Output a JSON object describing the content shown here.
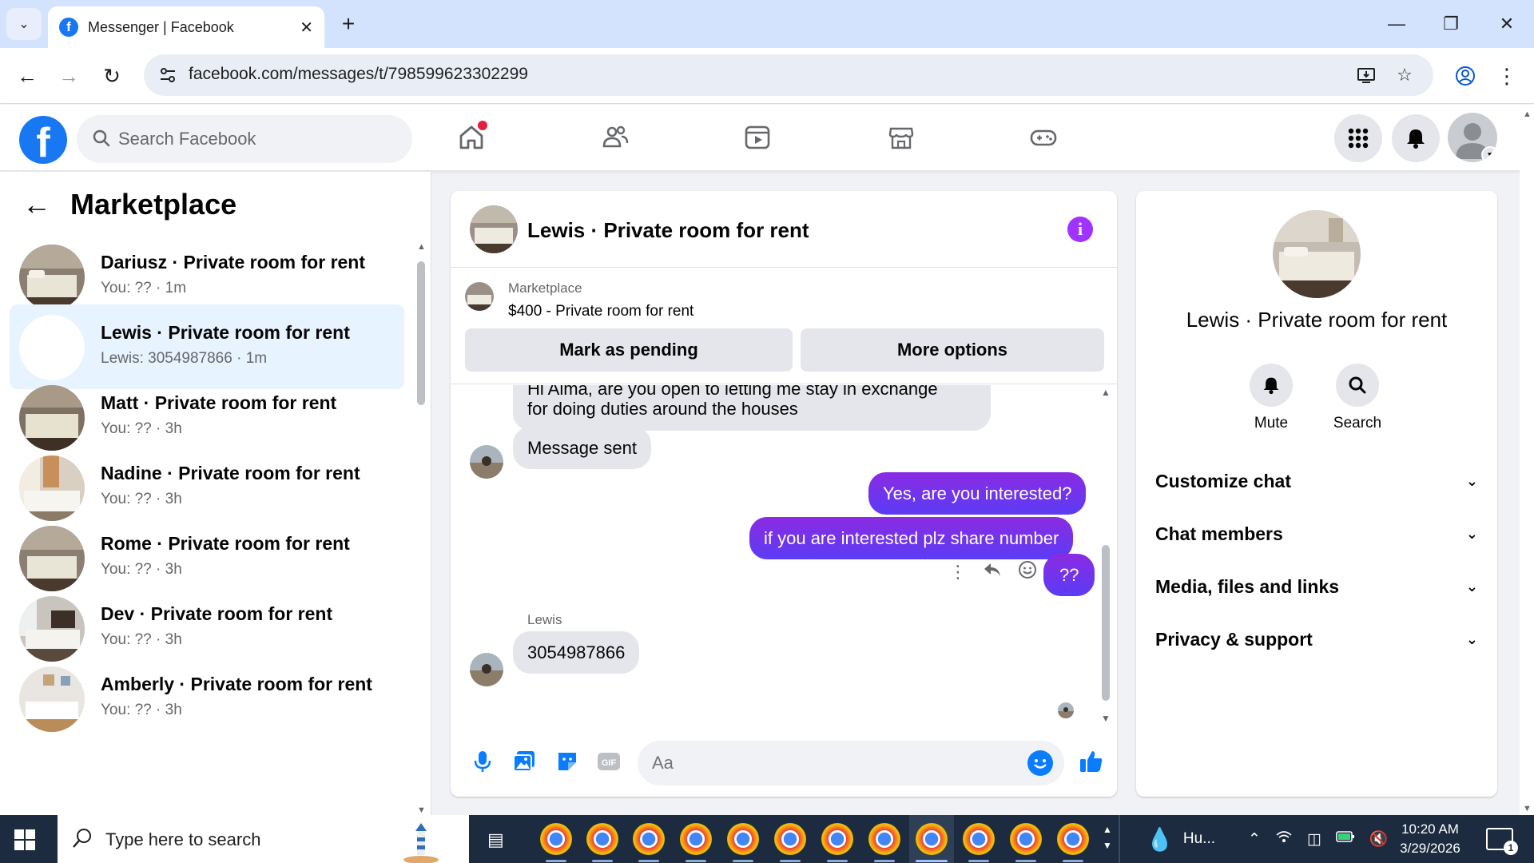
{
  "browser": {
    "tab_title": "Messenger | Facebook",
    "url": "facebook.com/messages/t/798599623302299"
  },
  "header": {
    "search_placeholder": "Search Facebook",
    "brand_color": "#1877f2"
  },
  "sidebar": {
    "title": "Marketplace",
    "conversations": [
      {
        "name": "Dariusz · Private room for rent",
        "sub": "You: ?? · 1m",
        "active": false
      },
      {
        "name": "Lewis · Private room for rent",
        "sub": "Lewis: 3054987866 · 1m",
        "active": true
      },
      {
        "name": "Matt · Private room for rent",
        "sub": "You: ?? · 3h",
        "active": false
      },
      {
        "name": "Nadine · Private room for rent",
        "sub": "You: ?? · 3h",
        "active": false
      },
      {
        "name": "Rome · Private room for rent",
        "sub": "You: ?? · 3h",
        "active": false
      },
      {
        "name": "Dev · Private room for rent",
        "sub": "You: ?? · 3h",
        "active": false
      },
      {
        "name": "Amberly · Private room for rent",
        "sub": "You: ?? · 3h",
        "active": false
      }
    ]
  },
  "chat": {
    "title": "Lewis · Private room for rent",
    "marketplace_label": "Marketplace",
    "listing": "$400 - Private room for rent",
    "mark_pending": "Mark as pending",
    "more_options": "More options",
    "messages": {
      "partial_line1": "Hi Alma, are you open to letting me stay in exchange",
      "partial_line2": "for doing duties around the houses",
      "sent_notice": "Message sent",
      "out1": "Yes, are you interested?",
      "out2": "if you are interested plz share number",
      "out3": "??",
      "sender": "Lewis",
      "in_number": "3054987866"
    },
    "composer_placeholder": "Aa",
    "accent_color": "#7b2cf7"
  },
  "info_panel": {
    "name": "Lewis · Private room for rent",
    "mute": "Mute",
    "search": "Search",
    "sections": [
      "Customize chat",
      "Chat members",
      "Media, files and links",
      "Privacy & support"
    ]
  },
  "taskbar": {
    "search_text": "Type here to search",
    "weather": "Hu...",
    "time": "10:20 AM",
    "date": "3/29/2026",
    "notifications": "1"
  }
}
